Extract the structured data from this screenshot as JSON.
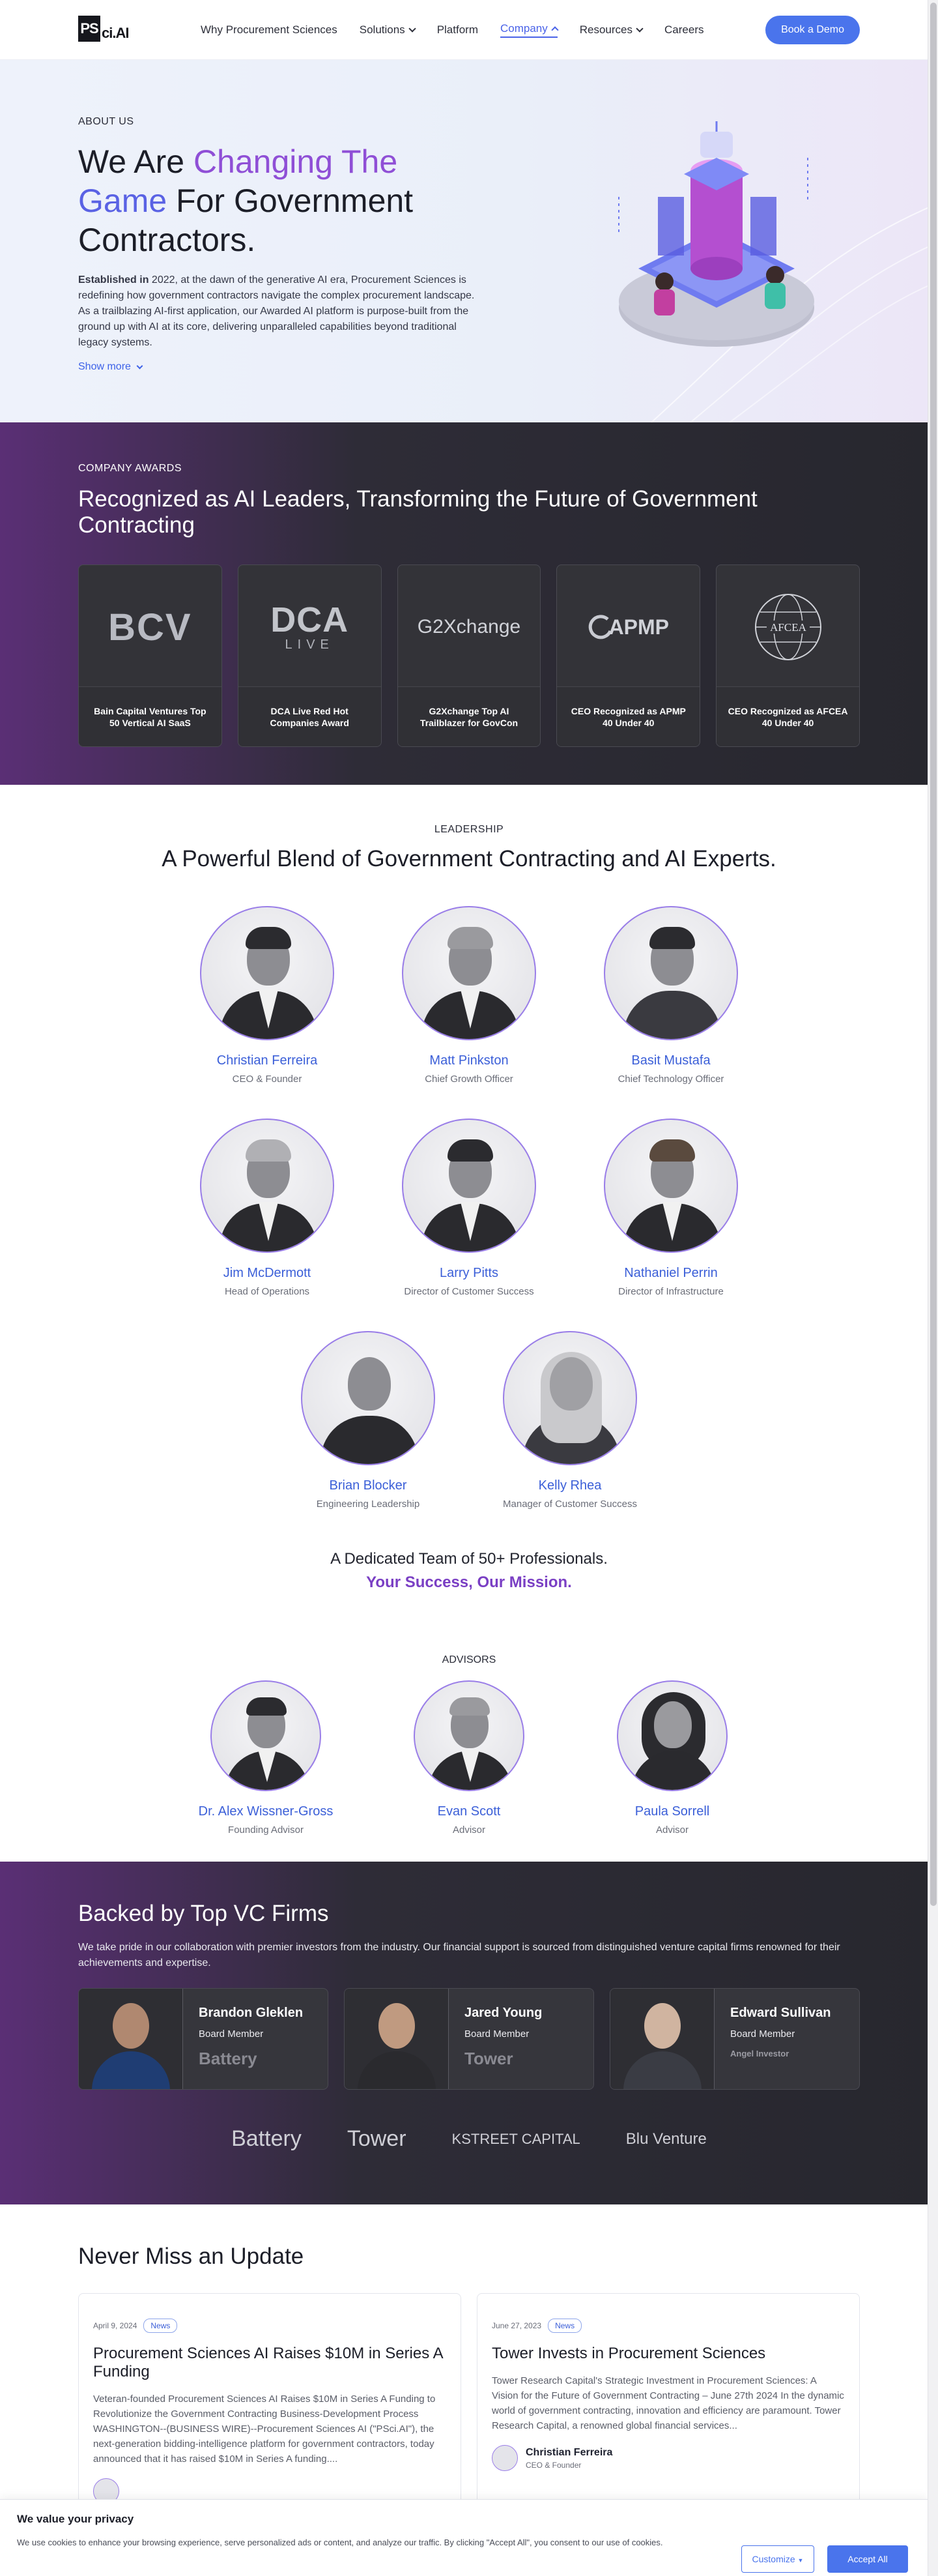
{
  "nav": {
    "logo_text": "PS",
    "logo_suffix": "ci.AI",
    "links": [
      {
        "label": "Why Procurement Sciences"
      },
      {
        "label": "Solutions"
      },
      {
        "label": "Platform"
      },
      {
        "label": "Company"
      },
      {
        "label": "Resources"
      },
      {
        "label": "Careers"
      }
    ],
    "demo_label": "Book a Demo",
    "accent": "#4a74ec"
  },
  "hero": {
    "eyebrow": "ABOUT US",
    "title_pre": "We Are ",
    "title_g1": "Changing The",
    "title_g2": "Game",
    "title_post": " For Government Contractors.",
    "intro_bold": "Established in",
    "intro_text": " 2022, at the dawn of the generative AI era, Procurement Sciences is redefining how government contractors navigate the complex procurement landscape. As a trailblazing AI-first application, our Awarded AI platform is purpose-built from the ground up with AI at its core, delivering unparalleled capabilities beyond traditional legacy systems.",
    "show_more": "Show more"
  },
  "awards": {
    "eyebrow": "COMPANY AWARDS",
    "title": "Recognized as AI Leaders, Transforming the Future of Government Contracting",
    "items": [
      {
        "logo": "BCV",
        "caption": "Bain Capital Ventures Top 50 Vertical AI SaaS"
      },
      {
        "logo": "DCA",
        "logo_sub": "LIVE",
        "caption": "DCA Live Red Hot Companies Award"
      },
      {
        "logo": "G2Xchange",
        "caption": "G2Xchange Top AI Trailblazer for GovCon"
      },
      {
        "logo": "APMP",
        "caption": "CEO Recognized as APMP 40 Under 40"
      },
      {
        "logo": "AFCEA",
        "caption": "CEO Recognized as AFCEA 40 Under 40"
      }
    ]
  },
  "leadership": {
    "eyebrow": "LEADERSHIP",
    "title": "A Powerful Blend of Government Contracting and AI Experts.",
    "people": [
      {
        "name": "Christian Ferreira",
        "role": "CEO & Founder"
      },
      {
        "name": "Matt Pinkston",
        "role": "Chief Growth Officer"
      },
      {
        "name": "Basit Mustafa",
        "role": "Chief Technology Officer"
      },
      {
        "name": "Jim McDermott",
        "role": "Head of Operations"
      },
      {
        "name": "Larry Pitts",
        "role": "Director of Customer Success"
      },
      {
        "name": "Nathaniel Perrin",
        "role": "Director of Infrastructure"
      },
      {
        "name": "Brian Blocker",
        "role": "Engineering Leadership"
      },
      {
        "name": "Kelly Rhea",
        "role": "Manager of Customer Success"
      }
    ],
    "team_line": "A Dedicated Team of 50+ Professionals.",
    "team_mission": "Your Success, Our Mission."
  },
  "advisors": {
    "eyebrow": "ADVISORS",
    "people": [
      {
        "name": "Dr. Alex Wissner-Gross",
        "role": "Founding Advisor"
      },
      {
        "name": "Evan Scott",
        "role": "Advisor"
      },
      {
        "name": "Paula Sorrell",
        "role": "Advisor"
      }
    ]
  },
  "vc": {
    "title": "Backed by Top VC Firms",
    "text": "We take pride in our collaboration with premier investors from the industry. Our financial support is sourced from distinguished venture capital firms renowned for their achievements and expertise.",
    "cards": [
      {
        "name": "Brandon Gleklen",
        "role": "Board Member",
        "firm": "Battery"
      },
      {
        "name": "Jared Young",
        "role": "Board Member",
        "firm": "Tower"
      },
      {
        "name": "Edward Sullivan",
        "role": "Board Member",
        "firm": "Angel Investor"
      }
    ],
    "logos": [
      "Battery",
      "Tower",
      "KSTREET CAPITAL",
      "Blu Venture"
    ]
  },
  "news": {
    "title": "Never Miss an Update",
    "items": [
      {
        "date": "April 9, 2024",
        "tag": "News",
        "headline": "Procurement Sciences AI Raises $10M in Series A Funding",
        "excerpt": "Veteran-founded Procurement Sciences AI Raises $10M in Series A Funding to Revolutionize the Government Contracting Business-Development Process WASHINGTON--(BUSINESS WIRE)--Procurement Sciences AI (\"PSci.AI\"), the next-generation bidding-intelligence platform for government contractors, today announced that it has raised $10M in Series A funding....",
        "author": "",
        "author_role": ""
      },
      {
        "date": "June 27, 2023",
        "tag": "News",
        "headline": "Tower Invests in Procurement Sciences",
        "excerpt": "Tower Research Capital's Strategic Investment in Procurement Sciences: A Vision for the Future of Government Contracting – June 27th 2024 In the dynamic world of government contracting, innovation and efficiency are paramount. Tower Research Capital, a renowned global financial services...",
        "author": "Christian Ferreira",
        "author_role": "CEO & Founder"
      }
    ]
  },
  "cookie": {
    "title": "We value your privacy",
    "text": "We use cookies to enhance your browsing experience, serve personalized ads or content, and analyze our traffic. By clicking \"Accept All\", you consent to our use of cookies.",
    "customize": "Customize",
    "accept": "Accept All"
  }
}
